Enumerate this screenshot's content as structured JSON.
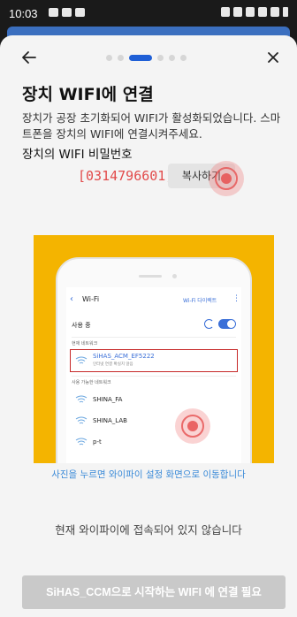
{
  "status_bar": {
    "time": "10:03",
    "left_icons": [
      "image-icon",
      "chat-icon",
      "gallery-icon"
    ],
    "right_icons": [
      "alarm-icon",
      "mute-icon",
      "wifi-icon",
      "lte-icon",
      "signal-icon",
      "battery-icon"
    ]
  },
  "stepper": {
    "total_steps": 6,
    "active_step": 3
  },
  "header": {
    "title": "장치 WIFI에 연결",
    "description": "장치가 공장 초기화되어 WIFI가 활성화되었습니다. 스마트폰을 장치의 WIFI에 연결시켜주세요."
  },
  "password": {
    "label": "장치의 WIFI 비밀번호",
    "value": "[0314796601]",
    "copy_label": "복사하기"
  },
  "guide_image": {
    "wifi_title": "Wi-Fi",
    "wifi_direct": "Wi-Fi 다이렉트",
    "in_use": "사용 중",
    "current_network_label": "현재 네트워크",
    "selected_ssid": "SiHAS_ACM_EF5222",
    "selected_ssid_sub": "인터넷 연결 확실치 않음",
    "available_label": "사용 가능한 네트워크",
    "networks": [
      "SHINA_FA",
      "SHINA_LAB",
      "p-t"
    ],
    "background_color": "#f4b400"
  },
  "guide_link": "사진을 누르면 와이파이 설정 화면으로 이동합니다",
  "status_message": "현재 와이파이에 접속되어 있지 않습니다",
  "connect_button": "SiHAS_CCM으로 시작하는 WIFI 에 연결 필요",
  "colors": {
    "accent": "#1f5fd6",
    "password": "#e24b4b",
    "link": "#3a8ad8",
    "disabled_button": "#c9c9c9"
  }
}
